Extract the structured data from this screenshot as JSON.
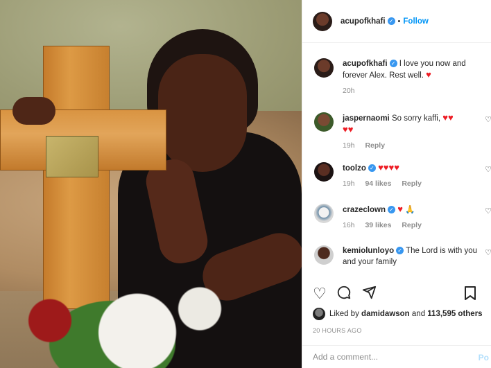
{
  "post": {
    "author": "acupofkhafi",
    "follow_label": "Follow",
    "caption_user": "acupofkhafi",
    "caption_text": "I love you now and forever Alex. Rest well.",
    "caption_time": "20h"
  },
  "comments": [
    {
      "user": "jaspernaomi",
      "text": "So sorry kaffi,",
      "time": "19h",
      "likes": "",
      "reply": "Reply",
      "verified": false
    },
    {
      "user": "toolzo",
      "text": "",
      "time": "19h",
      "likes": "94 likes",
      "reply": "Reply",
      "verified": true
    },
    {
      "user": "crazeclown",
      "text": "",
      "time": "16h",
      "likes": "39 likes",
      "reply": "Reply",
      "verified": true
    },
    {
      "user": "kemiolunloyo",
      "text": "The Lord is with you and your family",
      "time": "",
      "likes": "",
      "reply": "",
      "verified": true
    }
  ],
  "likes": {
    "prefix": "Liked by",
    "user": "damidawson",
    "and": "and",
    "count": "113,595 others"
  },
  "timestamp": "20 HOURS AGO",
  "add_comment": {
    "placeholder": "Add a comment...",
    "post_label": "Po"
  },
  "icons": {
    "like": "heart-icon",
    "comment": "comment-icon",
    "share": "share-icon",
    "save": "bookmark-icon"
  },
  "colors": {
    "accent": "#0095f6",
    "verified": "#3897f0",
    "heart": "#ed1c24"
  }
}
